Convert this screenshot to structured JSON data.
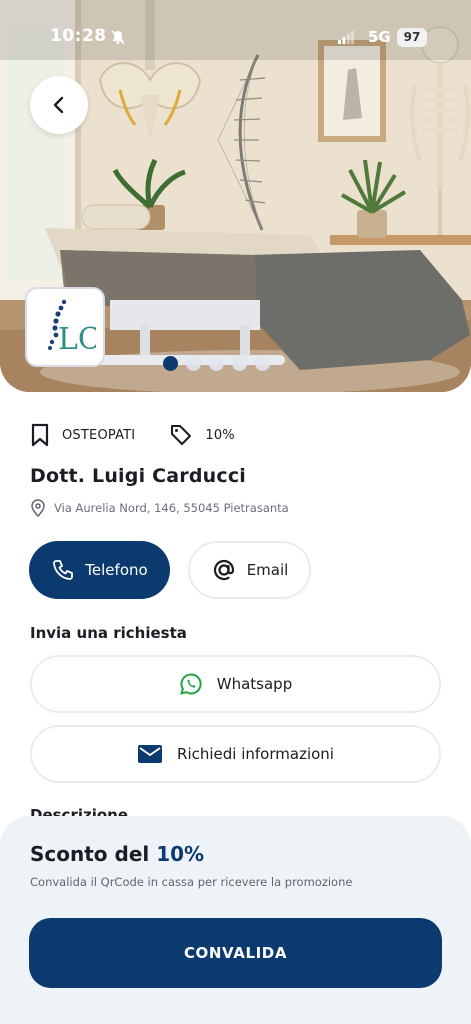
{
  "status_bar": {
    "time": "10:28",
    "network": "5G",
    "battery": "97"
  },
  "hero": {
    "logo_text": "LC",
    "active_slide": 1,
    "slide_count": 5
  },
  "info": {
    "category": "OSTEOPATI",
    "discount_tag": "10%",
    "name": "Dott. Luigi Carducci",
    "address": "Via Aurelia Nord, 146, 55045 Pietrasanta"
  },
  "contact": {
    "phone_label": "Telefono",
    "email_label": "Email"
  },
  "request": {
    "title": "Invia una richiesta",
    "whatsapp_label": "Whatsapp",
    "info_label": "Richiedi informazioni"
  },
  "description": {
    "title": "Descrizione"
  },
  "sheet": {
    "title_prefix": "Sconto del",
    "title_value": "10%",
    "subtitle": "Convalida il QrCode in cassa per ricevere la promozione",
    "cta_label": "CONVALIDA"
  },
  "colors": {
    "primary": "#0b3a6f",
    "whatsapp": "#25a244",
    "sheet_bg": "#eef3f8"
  }
}
